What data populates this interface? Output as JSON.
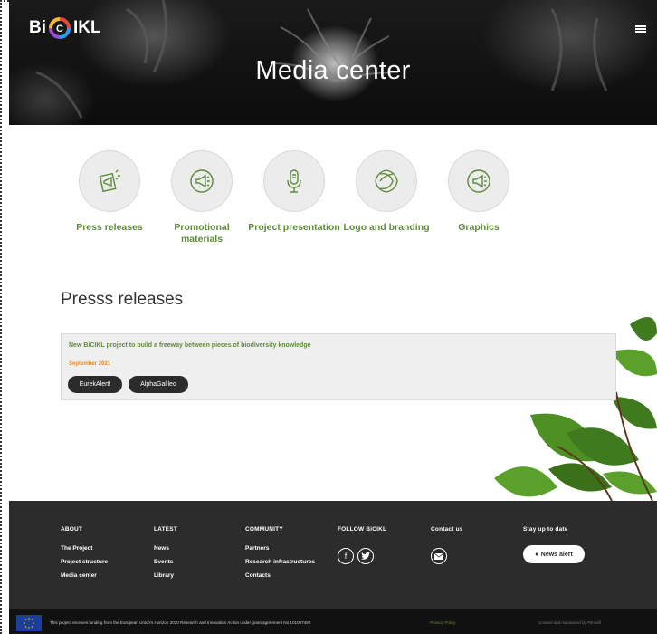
{
  "header": {
    "logo_text_left": "Bi",
    "logo_text_right": "IKL",
    "title": "Media center"
  },
  "categories": [
    {
      "label": "Press releases",
      "icon": "megaphone-paper-icon"
    },
    {
      "label": "Promotional materials",
      "icon": "megaphone-icon"
    },
    {
      "label": "Project presentation",
      "icon": "microphone-icon"
    },
    {
      "label": "Logo and branding",
      "icon": "logo-icon"
    },
    {
      "label": "Graphics",
      "icon": "megaphone-icon"
    }
  ],
  "press": {
    "section_title": "Presss releases",
    "items": [
      {
        "title": "New BiCIKL project to build a freeway between pieces of biodiversity knowledge",
        "date": "September 2021",
        "links": [
          "EurekAlert!",
          "AlphaGalileo"
        ]
      }
    ]
  },
  "footer": {
    "about": {
      "heading": "ABOUT",
      "links": [
        "The Project",
        "Project structure",
        "Media center"
      ]
    },
    "latest": {
      "heading": "LATEST",
      "links": [
        "News",
        "Events",
        "Library"
      ]
    },
    "community": {
      "heading": "COMMUNITY",
      "links": [
        "Partners",
        "Research infrastructures",
        "Contacts"
      ]
    },
    "follow": {
      "heading": "FOLLOW BiCIKL"
    },
    "contact": {
      "heading": "Contact us"
    },
    "stay": {
      "heading": "Stay up to date",
      "button": "News alert"
    }
  },
  "bottom": {
    "funding": "This project receives funding from the European Union's Horizon 2020 Research and Innovation Action under grant agreement No 101007492",
    "privacy": "Privacy Policy",
    "credit": "Created and maintained by Pensoft"
  },
  "colors": {
    "accent_green": "#5f8b3b",
    "date_orange": "#e08a2b",
    "footer_bg": "#2c2c2c"
  }
}
